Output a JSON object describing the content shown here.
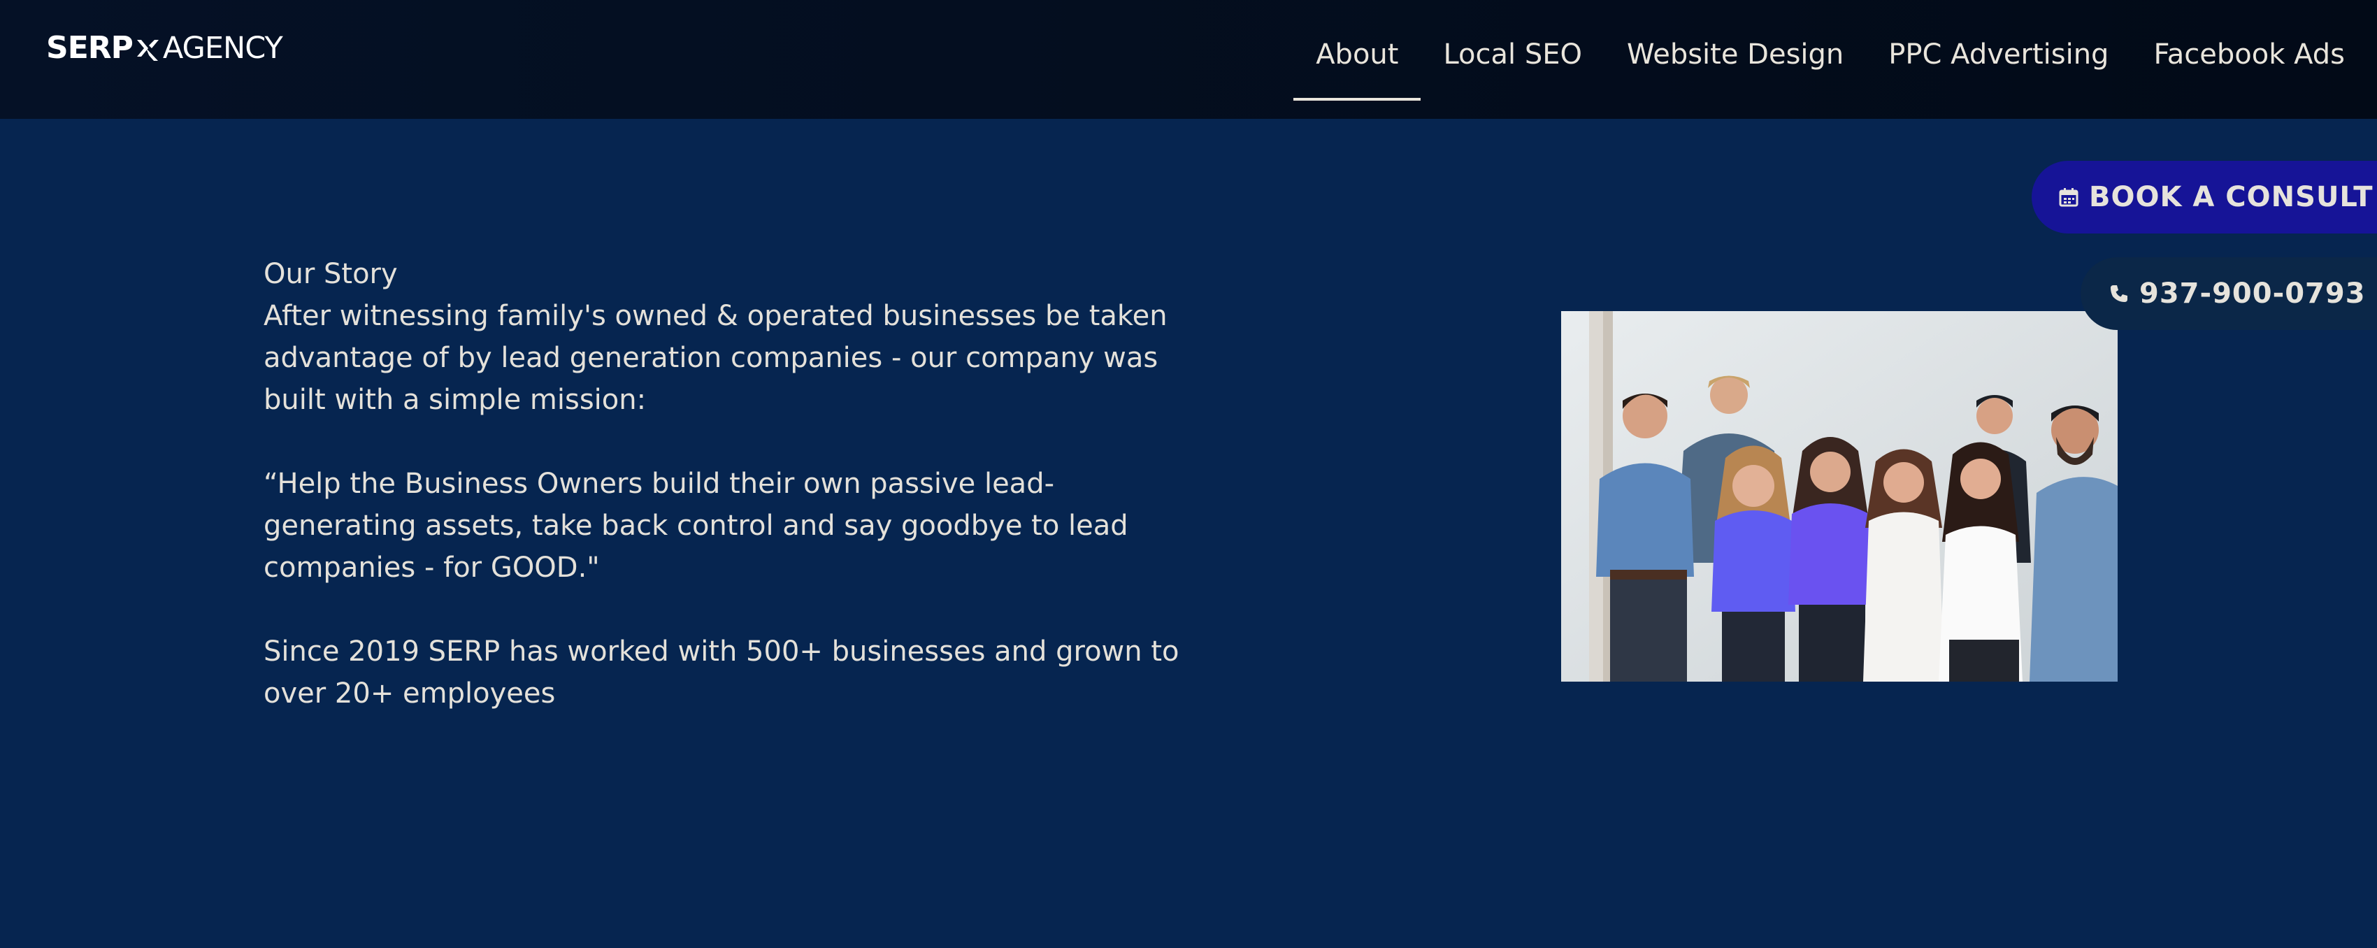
{
  "header": {
    "logo": {
      "bold_text": "SERP",
      "light_text": "AGENCY",
      "icon": "serp-x-mark-icon"
    },
    "nav": [
      {
        "label": "About",
        "active": true
      },
      {
        "label": "Local SEO",
        "active": false
      },
      {
        "label": "Website Design",
        "active": false
      },
      {
        "label": "PPC Advertising",
        "active": false
      },
      {
        "label": "Facebook Ads",
        "active": false
      }
    ]
  },
  "floating": {
    "book_label": "BOOK A CONSULT",
    "book_icon": "calendar-icon",
    "phone_label": "937-900-0793",
    "phone_icon": "phone-icon"
  },
  "story": {
    "heading": "Our Story",
    "intro": "After witnessing family's owned & operated businesses be taken advantage of by lead generation companies - our company was built with a simple mission:",
    "quote": "“Help the Business Owners build their own passive lead-generating assets, take back control and say goodbye to lead companies - for GOOD.\"",
    "closing": "Since 2019 SERP has worked with 500+ businesses and grown to over 20+ employees"
  },
  "photo": {
    "subject": "team-photo"
  },
  "colors": {
    "header_bg": "#030d1d",
    "page_bg": "#062550",
    "book_button_bg": "#161497",
    "phone_button_bg": "#0b2748",
    "text": "#e4e1da"
  }
}
